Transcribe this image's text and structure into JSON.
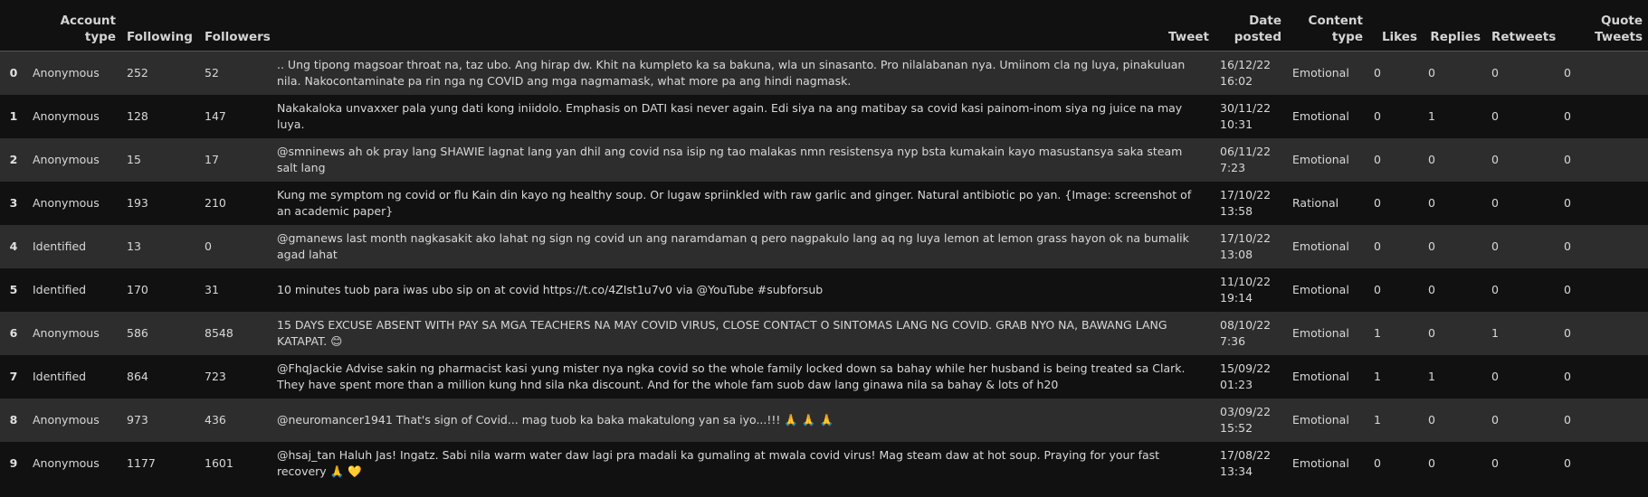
{
  "columns": {
    "account_type": "Account type",
    "following": "Following",
    "followers": "Followers",
    "tweet": "Tweet",
    "date_posted": "Date posted",
    "content_type": "Content type",
    "likes": "Likes",
    "replies": "Replies",
    "retweets": "Retweets",
    "quote_tweets": "Quote Tweets"
  },
  "rows": [
    {
      "idx": "0",
      "account_type": "Anonymous",
      "following": "252",
      "followers": "52",
      "tweet": ".. Ung tipong magsoar throat na, taz ubo. Ang hirap dw. Khit na kumpleto ka sa bakuna, wla un sinasanto. Pro nilalabanan nya. Umiinom cla ng luya, pinakuluan nila. Nakocontaminate pa rin nga ng COVID ang mga nagmamask, what more pa ang hindi nagmask.",
      "date_posted": "16/12/22 16:02",
      "content_type": "Emotional",
      "likes": "0",
      "replies": "0",
      "retweets": "0",
      "quote_tweets": "0"
    },
    {
      "idx": "1",
      "account_type": "Anonymous",
      "following": "128",
      "followers": "147",
      "tweet": "Nakakaloka unvaxxer pala yung dati kong iniidolo. Emphasis on DATI kasi never again. Edi siya na ang matibay sa covid kasi painom-inom siya ng juice na may luya.",
      "date_posted": "30/11/22 10:31",
      "content_type": "Emotional",
      "likes": "0",
      "replies": "1",
      "retweets": "0",
      "quote_tweets": "0"
    },
    {
      "idx": "2",
      "account_type": "Anonymous",
      "following": "15",
      "followers": "17",
      "tweet": "@smninews ah ok pray lang SHAWIE lagnat lang yan dhil ang covid nsa isip ng tao malakas nmn resistensya nyp bsta kumakain kayo masustansya saka steam salt lang",
      "date_posted": "06/11/22 7:23",
      "content_type": "Emotional",
      "likes": "0",
      "replies": "0",
      "retweets": "0",
      "quote_tweets": "0"
    },
    {
      "idx": "3",
      "account_type": "Anonymous",
      "following": "193",
      "followers": "210",
      "tweet": "Kung me symptom ng covid or flu Kain din kayo ng healthy soup. Or lugaw spriinkled with raw garlic and ginger. Natural antibiotic po yan. {Image: screenshot of an academic paper}",
      "date_posted": "17/10/22 13:58",
      "content_type": "Rational",
      "likes": "0",
      "replies": "0",
      "retweets": "0",
      "quote_tweets": "0"
    },
    {
      "idx": "4",
      "account_type": "Identified",
      "following": "13",
      "followers": "0",
      "tweet": "@gmanews last month nagkasakit ako lahat ng sign ng covid un ang naramdaman q pero nagpakulo lang aq ng luya lemon at lemon grass hayon ok na bumalik agad lahat",
      "date_posted": "17/10/22 13:08",
      "content_type": "Emotional",
      "likes": "0",
      "replies": "0",
      "retweets": "0",
      "quote_tweets": "0"
    },
    {
      "idx": "5",
      "account_type": "Identified",
      "following": "170",
      "followers": "31",
      "tweet": "10 minutes tuob para iwas ubo sip on at covid https://t.co/4ZIst1u7v0 via @YouTube #subforsub",
      "date_posted": "11/10/22 19:14",
      "content_type": "Emotional",
      "likes": "0",
      "replies": "0",
      "retweets": "0",
      "quote_tweets": "0"
    },
    {
      "idx": "6",
      "account_type": "Anonymous",
      "following": "586",
      "followers": "8548",
      "tweet": "15 DAYS EXCUSE ABSENT WITH PAY SA MGA TEACHERS NA MAY COVID VIRUS, CLOSE CONTACT O SINTOMAS LANG NG COVID. GRAB NYO NA, BAWANG LANG KATAPAT. 😊",
      "date_posted": "08/10/22 7:36",
      "content_type": "Emotional",
      "likes": "1",
      "replies": "0",
      "retweets": "1",
      "quote_tweets": "0"
    },
    {
      "idx": "7",
      "account_type": "Identified",
      "following": "864",
      "followers": "723",
      "tweet": "@FhqJackie Advise sakin ng pharmacist kasi yung mister nya ngka covid so the whole family locked down sa bahay while her husband is being treated sa Clark. They have spent more than a million kung hnd sila nka discount. And for the whole fam suob daw lang ginawa nila sa bahay & lots of h20",
      "date_posted": "15/09/22 01:23",
      "content_type": "Emotional",
      "likes": "1",
      "replies": "1",
      "retweets": "0",
      "quote_tweets": "0"
    },
    {
      "idx": "8",
      "account_type": "Anonymous",
      "following": "973",
      "followers": "436",
      "tweet": "@neuromancer1941 That's sign of Covid... mag tuob ka baka makatulong yan sa iyo...!!! 🙏 🙏 🙏",
      "date_posted": "03/09/22 15:52",
      "content_type": "Emotional",
      "likes": "1",
      "replies": "0",
      "retweets": "0",
      "quote_tweets": "0"
    },
    {
      "idx": "9",
      "account_type": "Anonymous",
      "following": "1177",
      "followers": "1601",
      "tweet": "@hsaj_tan Haluh Jas! Ingatz. Sabi nila warm water daw lagi pra madali ka gumaling at mwala covid virus! Mag steam daw at hot soup. Praying for your fast recovery 🙏 💛",
      "date_posted": "17/08/22 13:34",
      "content_type": "Emotional",
      "likes": "0",
      "replies": "0",
      "retweets": "0",
      "quote_tweets": "0"
    }
  ]
}
